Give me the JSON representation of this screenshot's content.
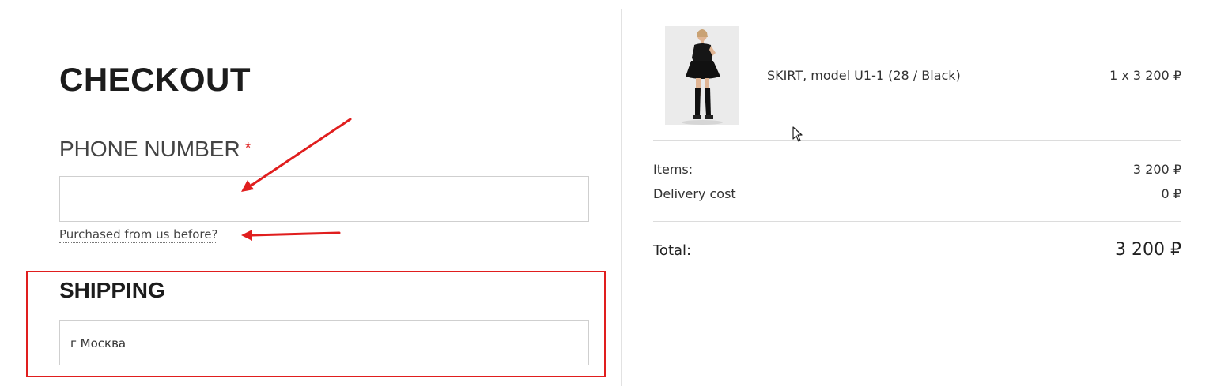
{
  "checkout": {
    "title": "CHECKOUT",
    "phone_label": "PHONE NUMBER",
    "required_mark": "*",
    "phone_value": "",
    "purchased_link": "Purchased from us before?"
  },
  "shipping": {
    "title": "SHIPPING",
    "address_value": "г Москва"
  },
  "order": {
    "product_image_icon": "product-photo",
    "product_name": "SKIRT, model U1-1 (28 / Black)",
    "product_qty_price": "1 x 3 200 ₽",
    "items_label": "Items:",
    "items_value": "3 200 ₽",
    "delivery_label": "Delivery cost",
    "delivery_value": "0 ₽",
    "total_label": "Total:",
    "total_value": "3 200 ₽"
  },
  "colors": {
    "annotation_red": "#e01e1e",
    "required_red": "#e02b2b"
  }
}
